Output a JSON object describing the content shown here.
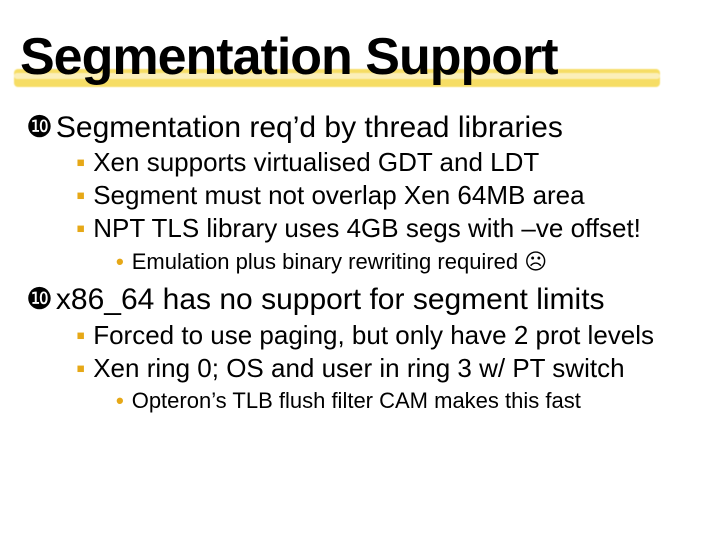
{
  "title": "Segmentation Support",
  "items": [
    {
      "bullet": "❿",
      "text": "Segmentation req’d by thread libraries",
      "children": [
        {
          "bullet": "▪",
          "text": "Xen supports virtualised GDT and LDT"
        },
        {
          "bullet": "▪",
          "text": "Segment must not overlap Xen 64MB area"
        },
        {
          "bullet": "▪",
          "text": "NPT TLS library uses 4GB segs with –ve offset!",
          "children": [
            {
              "bullet": "•",
              "text": "Emulation plus binary rewriting required ☹"
            }
          ]
        }
      ]
    },
    {
      "bullet": "❿",
      "text": "x86_64 has no support for segment limits",
      "children": [
        {
          "bullet": "▪",
          "text": "Forced to use paging, but only have 2 prot levels"
        },
        {
          "bullet": "▪",
          "text": "Xen ring 0; OS and user in ring 3 w/ PT switch",
          "children": [
            {
              "bullet": "•",
              "text": "Opteron’s TLB flush filter CAM makes this fast"
            }
          ]
        }
      ]
    }
  ]
}
